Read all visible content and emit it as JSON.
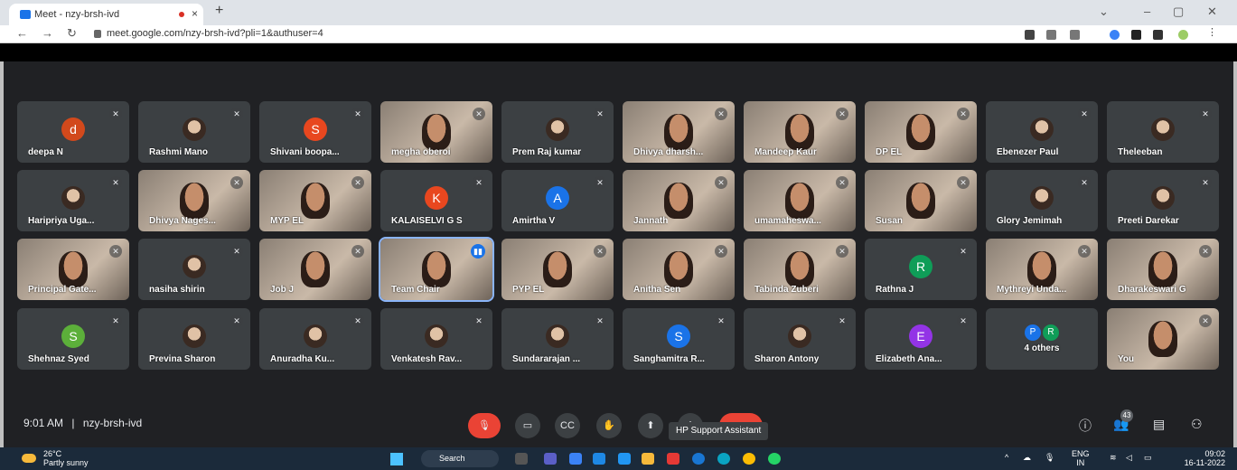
{
  "browser": {
    "tab_title": "Meet - nzy-brsh-ivd",
    "tab_close": "×",
    "new_tab": "+",
    "url": "meet.google.com/nzy-brsh-ivd?pli=1&authuser=4"
  },
  "tiles": [
    {
      "name": "deepa N",
      "kind": "letter",
      "letter": "d",
      "color": "#d2491c"
    },
    {
      "name": "Rashmi Mano",
      "kind": "photo"
    },
    {
      "name": "Shivani boopa...",
      "kind": "letter",
      "letter": "S",
      "color": "#e8471f"
    },
    {
      "name": "megha oberoi",
      "kind": "video"
    },
    {
      "name": "Prem Raj kumar",
      "kind": "photo"
    },
    {
      "name": "Dhivya dharsh...",
      "kind": "video"
    },
    {
      "name": "Mandeep Kaur",
      "kind": "video"
    },
    {
      "name": "DP EL",
      "kind": "video"
    },
    {
      "name": "Ebenezer Paul",
      "kind": "photo"
    },
    {
      "name": "Theleeban",
      "kind": "photo"
    },
    {
      "name": "Haripriya Uga...",
      "kind": "photo"
    },
    {
      "name": "Dhivya Nages...",
      "kind": "video"
    },
    {
      "name": "MYP EL",
      "kind": "video"
    },
    {
      "name": "KALAISELVI G S",
      "kind": "letter",
      "letter": "K",
      "color": "#e8471f"
    },
    {
      "name": "Amirtha V",
      "kind": "letter",
      "letter": "A",
      "color": "#1a73e8"
    },
    {
      "name": "Jannath",
      "kind": "video"
    },
    {
      "name": "umamaheswa...",
      "kind": "video"
    },
    {
      "name": "Susan",
      "kind": "video"
    },
    {
      "name": "Glory Jemimah",
      "kind": "photo"
    },
    {
      "name": "Preeti Darekar",
      "kind": "photo"
    },
    {
      "name": "Principal Gate...",
      "kind": "video"
    },
    {
      "name": "nasiha shirin",
      "kind": "photo"
    },
    {
      "name": "Job J",
      "kind": "video"
    },
    {
      "name": "Team Chair",
      "kind": "video",
      "speaking": true
    },
    {
      "name": "PYP EL",
      "kind": "video"
    },
    {
      "name": "Anitha Sen",
      "kind": "video"
    },
    {
      "name": "Tabinda Zuberi",
      "kind": "video"
    },
    {
      "name": "Rathna J",
      "kind": "letter",
      "letter": "R",
      "color": "#0f9d58"
    },
    {
      "name": "Mythreyi Unda...",
      "kind": "video"
    },
    {
      "name": "Dharakeswari G",
      "kind": "video"
    },
    {
      "name": "Shehnaz Syed",
      "kind": "letter",
      "letter": "S",
      "color": "#5caf3a"
    },
    {
      "name": "Previna Sharon",
      "kind": "photo"
    },
    {
      "name": "Anuradha Ku...",
      "kind": "photo"
    },
    {
      "name": "Venkatesh Rav...",
      "kind": "photo"
    },
    {
      "name": "Sundararajan ...",
      "kind": "photo"
    },
    {
      "name": "Sanghamitra R...",
      "kind": "letter",
      "letter": "S",
      "color": "#1a73e8"
    },
    {
      "name": "Sharon Antony",
      "kind": "photo"
    },
    {
      "name": "Elizabeth Ana...",
      "kind": "letter",
      "letter": "E",
      "color": "#9334e6"
    },
    {
      "name": "4 others",
      "kind": "others",
      "minis": [
        {
          "l": "P",
          "c": "#1a73e8"
        },
        {
          "l": "R",
          "c": "#0f9d58"
        }
      ]
    },
    {
      "name": "You",
      "kind": "video"
    }
  ],
  "meeting": {
    "time": "9:01 AM",
    "separator": "|",
    "code": "nzy-brsh-ivd",
    "participant_count": "43"
  },
  "controls": {
    "tooltip": "HP Support Assistant"
  },
  "taskbar": {
    "temp": "26°C",
    "condition": "Partly sunny",
    "search": "Search",
    "lang_top": "ENG",
    "lang_bottom": "IN",
    "time": "09:02",
    "date": "16-11-2022"
  }
}
